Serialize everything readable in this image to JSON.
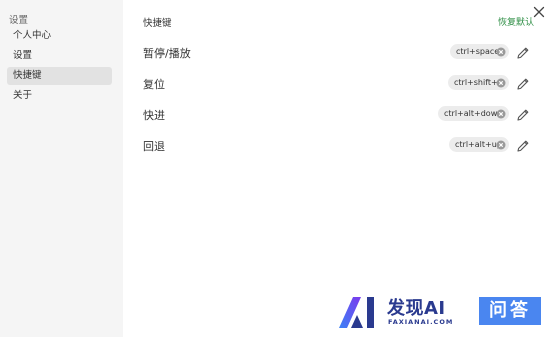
{
  "sidebar": {
    "title": "设置",
    "items": [
      {
        "label": "个人中心"
      },
      {
        "label": "设置"
      },
      {
        "label": "快捷键"
      },
      {
        "label": "关于"
      }
    ]
  },
  "content": {
    "title": "快捷键",
    "reset_label": "恢复默认",
    "shortcuts": [
      {
        "label": "暂停/播放",
        "keys": "ctrl+space"
      },
      {
        "label": "复位",
        "keys": "ctrl+shift+r"
      },
      {
        "label": "快进",
        "keys": "ctrl+alt+down"
      },
      {
        "label": "回退",
        "keys": "ctrl+alt+up"
      }
    ]
  },
  "watermark": {
    "name": "发现AI",
    "domain": "FAXIANAI.COM",
    "badge": "问答"
  },
  "colors": {
    "accent_green": "#2f8f46",
    "sidebar_bg": "#f5f5f5",
    "active_item_bg": "#e2e2e2",
    "chip_bg": "#ececec",
    "watermark_blue": "#2a3a8f",
    "badge_blue": "#4a86f0"
  },
  "icons": {
    "close": "close-icon",
    "chip_clear": "clear-circle-icon",
    "edit": "pencil-icon"
  }
}
